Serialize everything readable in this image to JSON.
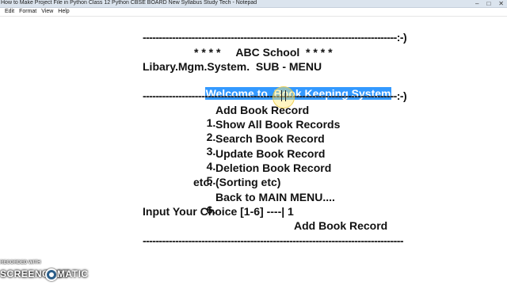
{
  "window": {
    "title": "How to Make Project File in Python Class 12 Python CBSE BOARD New Syllabus Study Tech - Notepad",
    "controls": [
      "–",
      "□",
      "✕"
    ]
  },
  "menu": {
    "items": [
      "Edit",
      "Format",
      "View",
      "Help"
    ]
  },
  "document": {
    "separator_top": "------------------------------------------------------------------------------:-)",
    "school_title": "* * * *     ABC School  * * * *",
    "system_header": "Libary.Mgm.System.  SUB - MENU",
    "welcome_selected": "Welcome to  Book Keeping System",
    "separator_mid": "------------------------------------------------------------------------------:-)",
    "menu_items": [
      {
        "num": "1.",
        "label": "Add Book Record"
      },
      {
        "num": "2.",
        "label": "Show All Book Records"
      },
      {
        "num": "3.",
        "label": "Search Book Record"
      },
      {
        "num": "4.",
        "label": "Update Book Record"
      },
      {
        "num": "5.",
        "label": "Deletion Book Record"
      }
    ],
    "etc_line": "etc. (Sorting etc)",
    "back_item": {
      "num": "6.",
      "label": "Back to MAIN MENU...."
    },
    "input_prompt": "Input Your Choice [1-6] ----| 1",
    "add_heading": "Add Book Record",
    "separator_bottom": "--------------------------------------------------------------------------------"
  },
  "watermark": {
    "recorded_with": "RECORDED WITH",
    "brand_left": "SCREENCAST",
    "brand_right": "MATIC"
  },
  "colors": {
    "selection": "#3399ff",
    "titlebar": "#dbe4ee",
    "text": "#111111"
  }
}
